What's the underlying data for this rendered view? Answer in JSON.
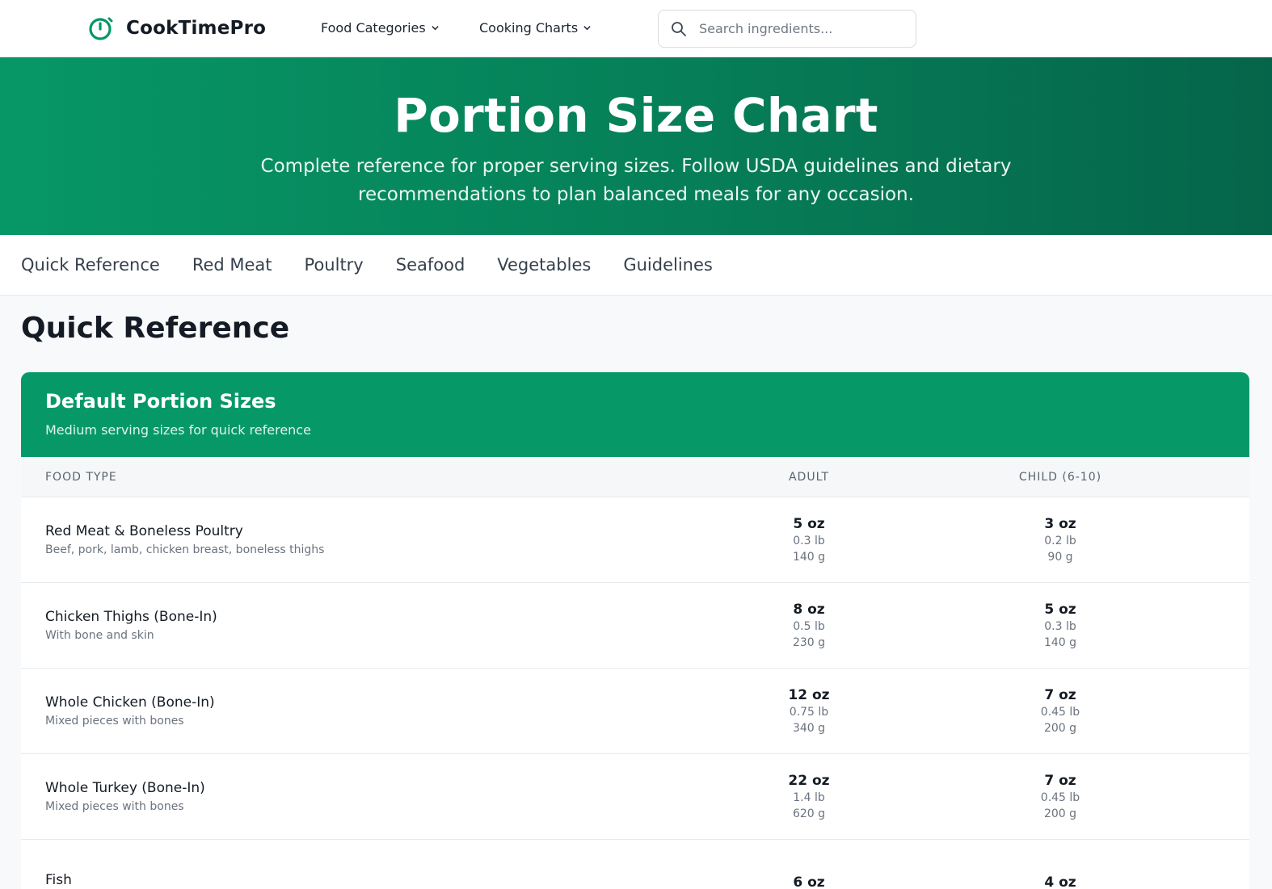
{
  "brand": {
    "name": "CookTimePro",
    "accent": "#079766"
  },
  "nav": {
    "menus": [
      {
        "label": "Food Categories",
        "icon": "chevron-down-icon"
      },
      {
        "label": "Cooking Charts",
        "icon": "chevron-down-icon"
      }
    ],
    "search": {
      "placeholder": "Search ingredients...",
      "value": "",
      "icon": "search-icon"
    }
  },
  "hero": {
    "title": "Portion Size Chart",
    "subtitle": "Complete reference for proper serving sizes. Follow USDA guidelines and dietary recommendations to plan balanced meals for any occasion."
  },
  "tabs": [
    "Quick Reference",
    "Red Meat",
    "Poultry",
    "Seafood",
    "Vegetables",
    "Guidelines"
  ],
  "section": {
    "title": "Quick Reference"
  },
  "card": {
    "title": "Default Portion Sizes",
    "subtitle": "Medium serving sizes for quick reference",
    "columns": {
      "food": "FOOD TYPE",
      "adult": "ADULT",
      "child": "CHILD (6-10)"
    },
    "rows": [
      {
        "name": "Red Meat & Boneless Poultry",
        "desc": "Beef, pork, lamb, chicken breast, boneless thighs",
        "adult": {
          "oz": "5 oz",
          "lb": "0.3 lb",
          "g": "140 g"
        },
        "child": {
          "oz": "3 oz",
          "lb": "0.2 lb",
          "g": "90 g"
        }
      },
      {
        "name": "Chicken Thighs (Bone-In)",
        "desc": "With bone and skin",
        "adult": {
          "oz": "8 oz",
          "lb": "0.5 lb",
          "g": "230 g"
        },
        "child": {
          "oz": "5 oz",
          "lb": "0.3 lb",
          "g": "140 g"
        }
      },
      {
        "name": "Whole Chicken (Bone-In)",
        "desc": "Mixed pieces with bones",
        "adult": {
          "oz": "12 oz",
          "lb": "0.75 lb",
          "g": "340 g"
        },
        "child": {
          "oz": "7 oz",
          "lb": "0.45 lb",
          "g": "200 g"
        }
      },
      {
        "name": "Whole Turkey (Bone-In)",
        "desc": "Mixed pieces with bones",
        "adult": {
          "oz": "22 oz",
          "lb": "1.4 lb",
          "g": "620 g"
        },
        "child": {
          "oz": "7 oz",
          "lb": "0.45 lb",
          "g": "200 g"
        }
      },
      {
        "name": "Fish",
        "desc": "",
        "adult": {
          "oz": "6 oz",
          "lb": "",
          "g": ""
        },
        "child": {
          "oz": "4 oz",
          "lb": "",
          "g": ""
        }
      }
    ]
  }
}
